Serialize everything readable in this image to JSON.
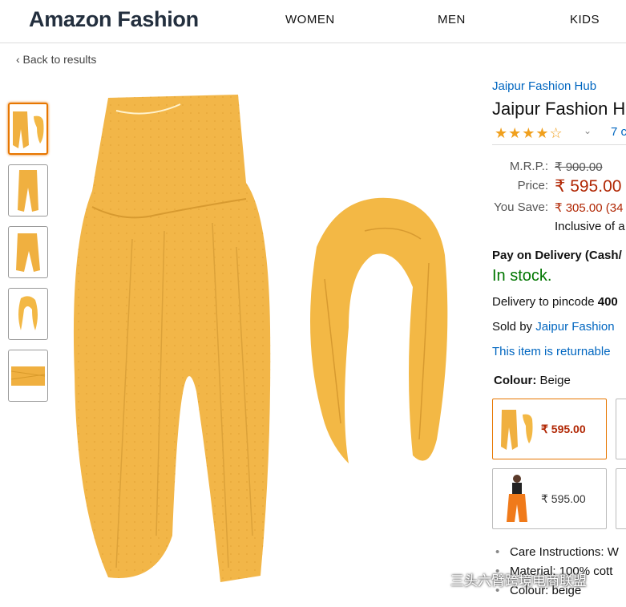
{
  "header": {
    "logo": "Amazon Fashion",
    "nav": [
      "WOMEN",
      "MEN",
      "KIDS"
    ]
  },
  "back_link": "‹ Back to results",
  "product": {
    "brand": "Jaipur Fashion Hub",
    "title": "Jaipur Fashion H",
    "rating_stars": 4.5,
    "ratings_count": "7 c",
    "mrp_label": "M.R.P.:",
    "mrp_value": "₹ 900.00",
    "price_label": "Price:",
    "price_value": "₹ 595.00",
    "save_label": "You Save:",
    "save_value": "₹ 305.00 (34",
    "inclusive": "Inclusive of a",
    "pay_on_delivery": "Pay on Delivery (Cash/",
    "stock": "In stock.",
    "delivery_prefix": "Delivery to pincode ",
    "delivery_pincode": "400",
    "sold_by_prefix": "Sold by ",
    "sold_by_link": "Jaipur Fashion",
    "returnable": "This item is returnable",
    "colour_label": "Colour:",
    "colour_value": " Beige",
    "swatches": [
      {
        "price": "₹ 595.00",
        "selected": true
      },
      {
        "price": "₹ 595.00",
        "selected": false
      }
    ],
    "bullets": [
      "Care Instructions: W",
      "Material: 100% cott",
      "Colour: beige"
    ]
  },
  "watermark": "三头六臂跨境电商联盟",
  "colors": {
    "accent": "#e77600",
    "price": "#b12704",
    "link": "#0066c0",
    "in_stock": "#007600",
    "product": "#f0b040"
  }
}
